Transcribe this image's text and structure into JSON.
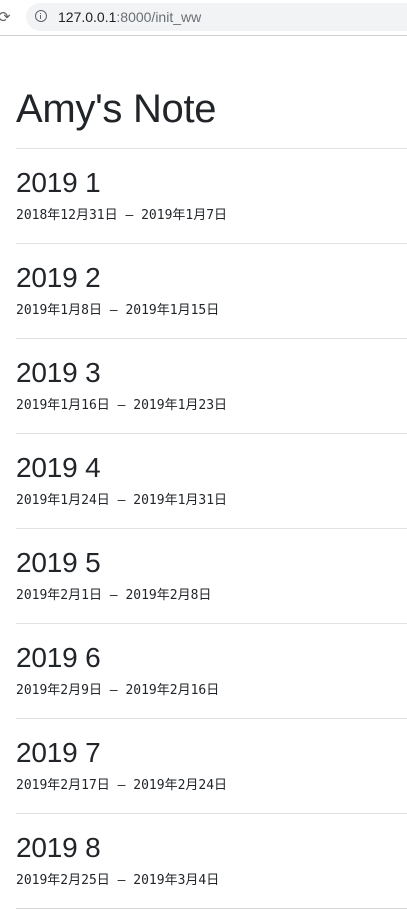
{
  "browser": {
    "url_host": "127.0.0.1",
    "url_rest": ":8000/init_ww"
  },
  "page": {
    "title": "Amy's Note"
  },
  "weeks": [
    {
      "title": "2019 1",
      "range": "2018年12月31日 – 2019年1月7日"
    },
    {
      "title": "2019 2",
      "range": "2019年1月8日 – 2019年1月15日"
    },
    {
      "title": "2019 3",
      "range": "2019年1月16日 – 2019年1月23日"
    },
    {
      "title": "2019 4",
      "range": "2019年1月24日 – 2019年1月31日"
    },
    {
      "title": "2019 5",
      "range": "2019年2月1日 – 2019年2月8日"
    },
    {
      "title": "2019 6",
      "range": "2019年2月9日 – 2019年2月16日"
    },
    {
      "title": "2019 7",
      "range": "2019年2月17日 – 2019年2月24日"
    },
    {
      "title": "2019 8",
      "range": "2019年2月25日 – 2019年3月4日"
    }
  ]
}
